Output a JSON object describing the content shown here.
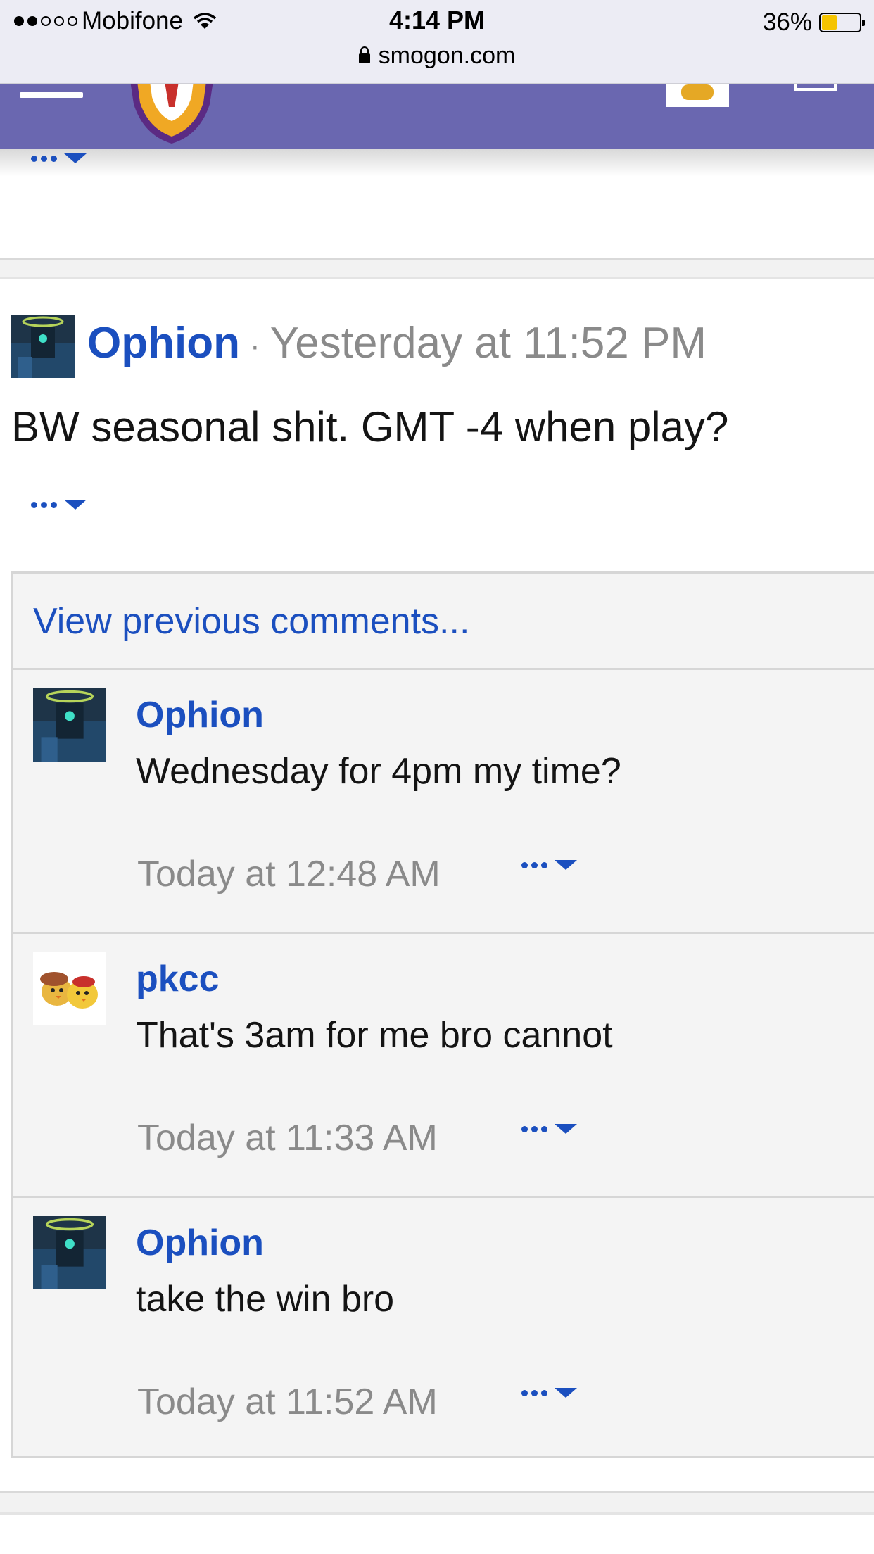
{
  "status_bar": {
    "carrier": "Mobifone",
    "time": "4:14 PM",
    "url": "smogon.com",
    "battery": "36%",
    "battery_level": 0.36,
    "signal_bars_filled": 2,
    "signal_bars_total": 5
  },
  "post": {
    "author": "Ophion",
    "separator": "·",
    "date": "Yesterday at 11:52 PM",
    "body": "BW seasonal shit. GMT -4 when play?"
  },
  "comments_box": {
    "view_previous": "View previous comments..."
  },
  "comments": [
    {
      "author": "Ophion",
      "text": "Wednesday for 4pm my time?",
      "date": "Today at 12:48 AM",
      "avatar": "ophion-avatar"
    },
    {
      "author": "pkcc",
      "text": "That's 3am for me bro cannot",
      "date": "Today at 11:33 AM",
      "avatar": "pkcc-avatar"
    },
    {
      "author": "Ophion",
      "text": "take the win bro",
      "date": "Today at 11:52 AM",
      "avatar": "ophion-avatar"
    }
  ],
  "colors": {
    "nav": "#6a67b0",
    "link": "#1b4fbf",
    "muted": "#8a8a8a",
    "comment_bg": "#f4f4f4"
  },
  "icons": {
    "wifi": "wifi-icon",
    "lock": "lock-icon",
    "battery": "battery-icon",
    "menu": "hamburger-icon",
    "more": "more-options-icon"
  }
}
